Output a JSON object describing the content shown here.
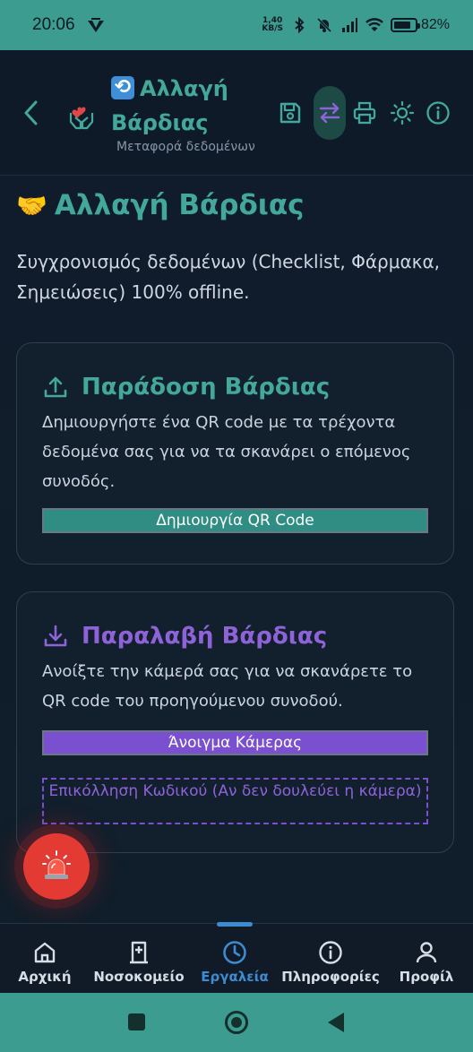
{
  "statusbar": {
    "time": "20:06",
    "speed_top": "1,40",
    "speed_bottom": "KB/S",
    "battery": "82%",
    "battery_level": 0.82
  },
  "header": {
    "title": "Αλλαγή Βάρδιας",
    "subtitle": "Μεταφορά δεδομένων"
  },
  "page": {
    "title": "Αλλαγή Βάρδιας",
    "description": "Συγχρονισμός δεδομένων (Checklist, Φάρμακα, Σημειώσεις) 100% offline."
  },
  "handover": {
    "title": "Παράδοση Βάρδιας",
    "description": "Δημιουργήστε ένα QR code με τα τρέχοντα δεδομένα σας για να τα σκανάρει ο επόμενος συνοδός.",
    "button": "Δημιουργία QR Code"
  },
  "receive": {
    "title": "Παραλαβή Βάρδιας",
    "description": "Ανοίξτε την κάμερά σας για να σκανάρετε το QR code του προηγούμενου συνοδού.",
    "camera_button": "Άνοιγμα Κάμερας",
    "paste_button": "Επικόλληση Κωδικού (Αν δεν δουλεύει η κάμερα)"
  },
  "nav": {
    "items": [
      {
        "label": "Αρχική",
        "icon": "home-icon"
      },
      {
        "label": "Νοσοκομείο",
        "icon": "hospital-icon"
      },
      {
        "label": "Εργαλεία",
        "icon": "clock-icon"
      },
      {
        "label": "Πληροφορίες",
        "icon": "info-icon"
      },
      {
        "label": "Προφίλ",
        "icon": "user-icon"
      }
    ],
    "active": "Εργαλεία"
  },
  "colors": {
    "teal": "#43a89b",
    "purple": "#8e63d8",
    "sos": "#e33a34",
    "nav_active": "#3d8bd0",
    "status_bar": "#3d9c90"
  }
}
